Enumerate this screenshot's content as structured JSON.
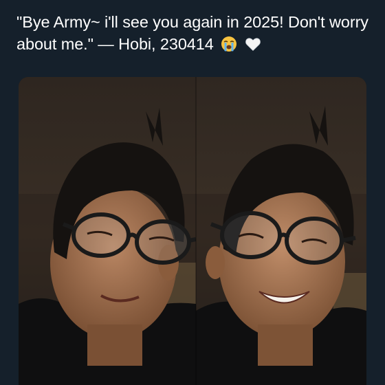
{
  "tweet": {
    "text": "\"Bye Army~ i'll see you again in 2025! Don't worry about me.\" — Hobi, 230414",
    "emojis": [
      "loudly-crying-face-icon",
      "white-heart-icon"
    ]
  },
  "media": {
    "photos": [
      {
        "name": "selfie-left",
        "expression": "soft smile"
      },
      {
        "name": "selfie-right",
        "expression": "big smile"
      }
    ]
  },
  "colors": {
    "background": "#15202b",
    "text": "#ffffff"
  }
}
